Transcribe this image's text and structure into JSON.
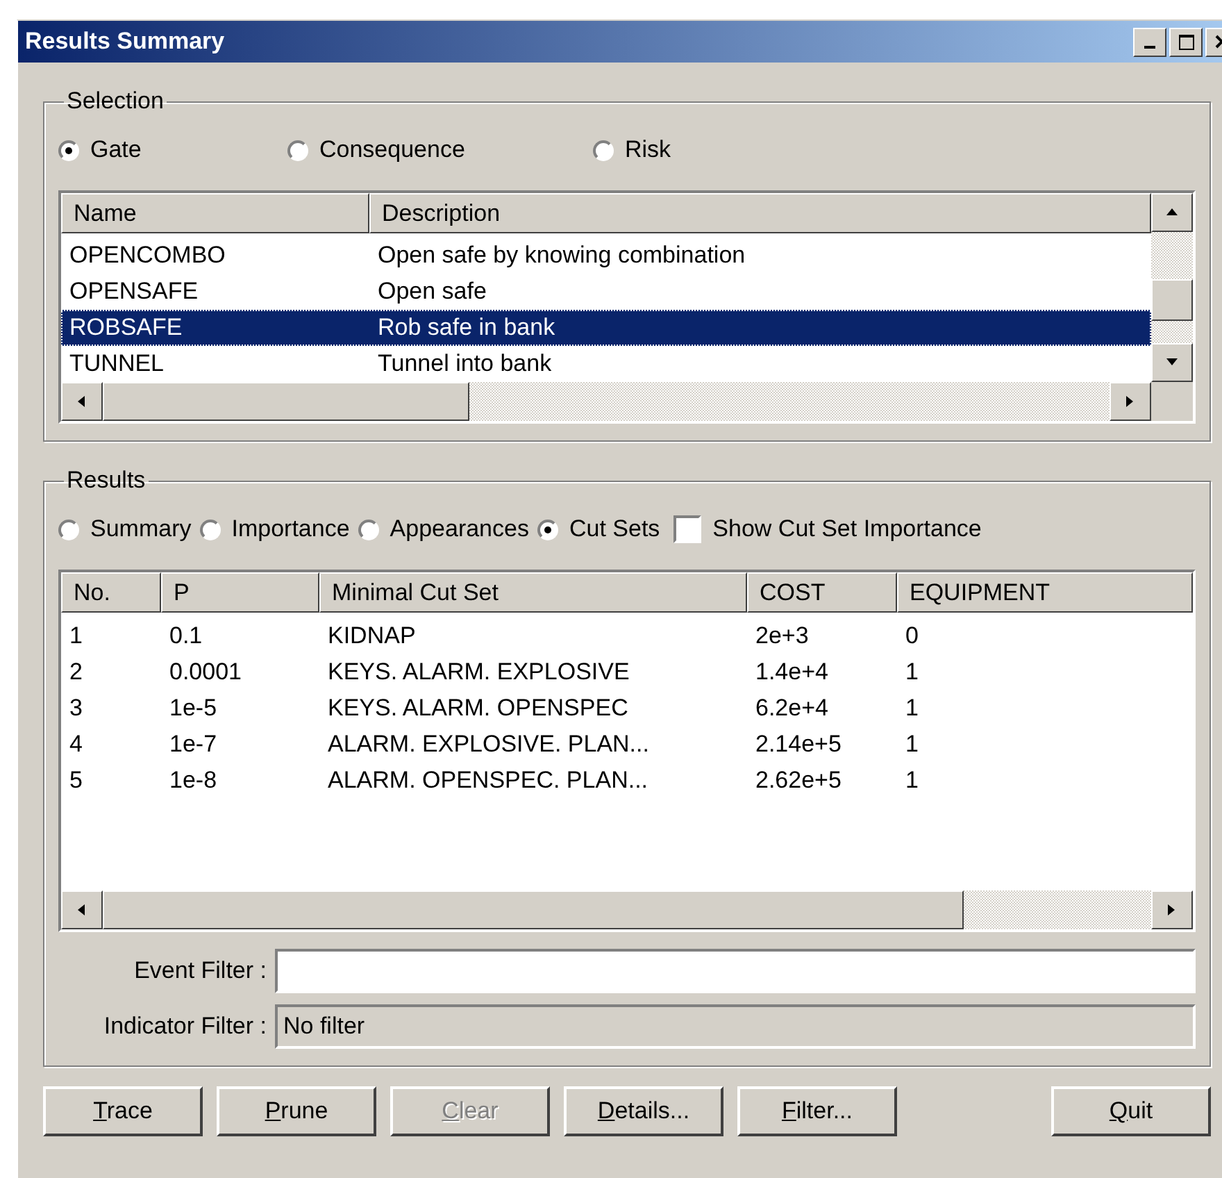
{
  "window": {
    "title": "Results Summary"
  },
  "selection": {
    "label": "Selection",
    "options": [
      {
        "label": "Gate",
        "selected": true
      },
      {
        "label": "Consequence",
        "selected": false
      },
      {
        "label": "Risk",
        "selected": false
      }
    ],
    "list": {
      "columns": [
        "Name",
        "Description"
      ],
      "rows": [
        {
          "cells": [
            "OPENCOMBO",
            "Open safe by knowing combination"
          ],
          "selected": false
        },
        {
          "cells": [
            "OPENSAFE",
            "Open safe"
          ],
          "selected": false
        },
        {
          "cells": [
            "ROBSAFE",
            "Rob safe in bank"
          ],
          "selected": true
        },
        {
          "cells": [
            "TUNNEL",
            "Tunnel into bank"
          ],
          "selected": false
        }
      ]
    }
  },
  "results": {
    "label": "Results",
    "options": [
      {
        "label": "Summary",
        "selected": false
      },
      {
        "label": "Importance",
        "selected": false
      },
      {
        "label": "Appearances",
        "selected": false
      },
      {
        "label": "Cut Sets",
        "selected": true
      }
    ],
    "show_importance": {
      "label": "Show Cut Set Importance",
      "checked": false
    },
    "table": {
      "columns": [
        "No.",
        "P",
        "Minimal Cut Set",
        "COST",
        "EQUIPMENT"
      ],
      "rows": [
        [
          "1",
          "0.1",
          "KIDNAP",
          "2e+3",
          "0"
        ],
        [
          "2",
          "0.0001",
          "KEYS. ALARM. EXPLOSIVE",
          "1.4e+4",
          "1"
        ],
        [
          "3",
          "1e-5",
          "KEYS. ALARM. OPENSPEC",
          "6.2e+4",
          "1"
        ],
        [
          "4",
          "1e-7",
          "ALARM. EXPLOSIVE. PLAN...",
          "2.14e+5",
          "1"
        ],
        [
          "5",
          "1e-8",
          "ALARM. OPENSPEC. PLAN...",
          "2.62e+5",
          "1"
        ]
      ]
    },
    "event_filter": {
      "label": "Event Filter :"
    },
    "indicator_filter": {
      "label": "Indicator Filter :",
      "value": "No filter"
    }
  },
  "buttons": [
    {
      "label": "Trace",
      "disabled": false,
      "access_key": true
    },
    {
      "label": "Prune",
      "disabled": false,
      "access_key": true
    },
    {
      "label": "Clear",
      "disabled": true,
      "access_key": true
    },
    {
      "label": "Details...",
      "disabled": false,
      "access_key": true
    },
    {
      "label": "Filter...",
      "disabled": false,
      "access_key": true
    },
    {
      "label": "Quit",
      "disabled": false,
      "access_key": true
    }
  ]
}
